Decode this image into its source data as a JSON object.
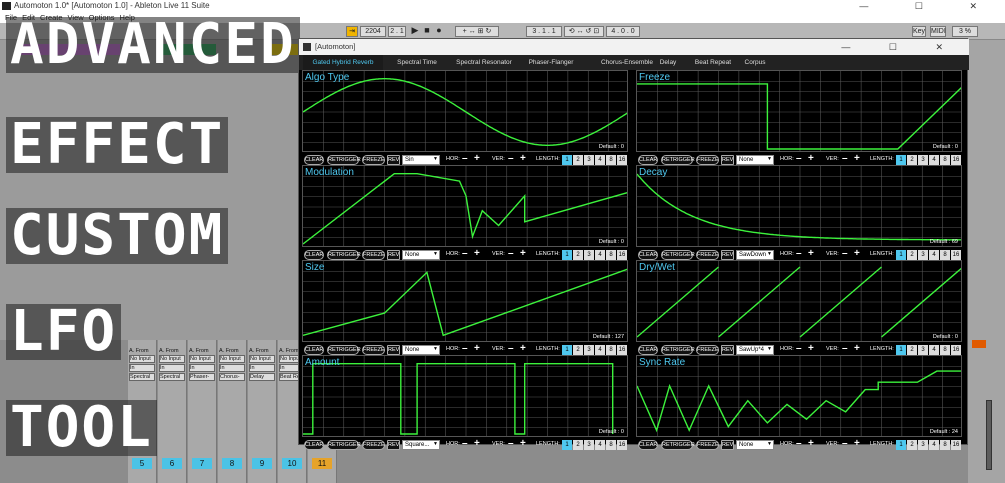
{
  "window": {
    "title": "Automoton 1.0* [Automoton 1.0] - Ableton Live 11 Suite",
    "controls": "— ☐ ✕"
  },
  "menu": [
    "File",
    "Edit",
    "Create",
    "View",
    "Options",
    "Help"
  ],
  "transport": {
    "tempo": "2204",
    "bars": "2 . 1",
    "position": "3 . 1 . 1",
    "loop": "4 . 0 . 0",
    "key": "Key",
    "midi": "MIDI",
    "zoom": "3 %"
  },
  "overlay": {
    "line1": "ADVANCED",
    "line2": "EFFECT",
    "line3": "CUSTOM",
    "line4": "LFO",
    "line5": "TOOL"
  },
  "plugin": {
    "title": "[Automoton]",
    "controls": "— ☐ ✕",
    "tabs": [
      "Gated Hybrid Reverb",
      "Spectral Time",
      "Spectral Resonator",
      "Phaser-Flanger",
      "Chorus-Ensemble",
      "Delay",
      "Beat Repeat",
      "Corpus"
    ],
    "active_tab": 0
  },
  "buttons": {
    "clear": "CLEAR",
    "retrigger": "RETRIGGER",
    "freeze": "FREEZE",
    "rev": "REV",
    "hor": "HOR:",
    "ver": "VER:",
    "length": "LENGTH:",
    "minus": "–",
    "plus": "+"
  },
  "length_values": [
    "1",
    "2",
    "3",
    "4",
    "8",
    "16"
  ],
  "panels": [
    {
      "name": "Algo Type",
      "shape": "Sin",
      "default": "Default : 0",
      "color": "#3cf23c"
    },
    {
      "name": "Freeze",
      "shape": "None",
      "default": "Default : 0",
      "color": "#3cf23c"
    },
    {
      "name": "Modulation",
      "shape": "None",
      "default": "Default : 0",
      "color": "#3cf23c"
    },
    {
      "name": "Decay",
      "shape": "SawDown",
      "default": "Default : 69",
      "color": "#3cf23c"
    },
    {
      "name": "Size",
      "shape": "None",
      "default": "Default : 127",
      "color": "#3cf23c"
    },
    {
      "name": "Dry/Wet",
      "shape": "SawUp*4",
      "default": "Default : 0",
      "color": "#3cf23c"
    },
    {
      "name": "Amount",
      "shape": "Square...",
      "default": "Default : 0",
      "color": "#3cf23c"
    },
    {
      "name": "Sync Rate",
      "shape": "None",
      "default": "Default : 24",
      "color": "#3cf23c"
    }
  ],
  "strips": [
    {
      "from": "A. From",
      "input": "No Input",
      "monitor": "In",
      "fx": "Spectral",
      "num": "5"
    },
    {
      "from": "A. From",
      "input": "No Input",
      "monitor": "In",
      "fx": "Spectral",
      "num": "6"
    },
    {
      "from": "A. From",
      "input": "No Input",
      "monitor": "In",
      "fx": "Phaser-",
      "num": "7"
    },
    {
      "from": "A. From",
      "input": "No Input",
      "monitor": "In",
      "fx": "Chorus-",
      "num": "8"
    },
    {
      "from": "A. From",
      "input": "No Input",
      "monitor": "In",
      "fx": "Delay",
      "num": "9"
    },
    {
      "from": "A. From",
      "input": "No Input",
      "monitor": "In",
      "fx": "Beat Rep",
      "num": "10"
    },
    {
      "from": "MIDI From",
      "input": "All Ins",
      "monitor": "Auto",
      "fx": "",
      "num": "11"
    }
  ]
}
